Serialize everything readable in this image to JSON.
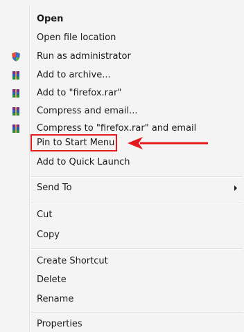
{
  "menu": {
    "items": [
      {
        "label": "Open",
        "bold": true,
        "icon": null
      },
      {
        "label": "Open file location",
        "icon": null
      },
      {
        "label": "Run as administrator",
        "icon": "uac-shield-icon"
      },
      {
        "label": "Add to archive...",
        "icon": "winrar-icon"
      },
      {
        "label": "Add to \"firefox.rar\"",
        "icon": "winrar-icon"
      },
      {
        "label": "Compress and email...",
        "icon": "winrar-icon"
      },
      {
        "label": "Compress to \"firefox.rar\" and email",
        "icon": "winrar-icon"
      },
      {
        "label": "Pin to Start Menu",
        "icon": null,
        "highlighted": true
      },
      {
        "label": "Add to Quick Launch",
        "icon": null
      },
      {
        "label": "Send To",
        "icon": null,
        "submenu": true
      },
      {
        "label": "Cut",
        "icon": null
      },
      {
        "label": "Copy",
        "icon": null
      },
      {
        "label": "Create Shortcut",
        "icon": null
      },
      {
        "label": "Delete",
        "icon": null
      },
      {
        "label": "Rename",
        "icon": null
      },
      {
        "label": "Properties",
        "icon": null
      }
    ]
  },
  "annotation": {
    "highlight_color": "#e3191c",
    "arrow_icon": "red-arrow-left-icon"
  }
}
